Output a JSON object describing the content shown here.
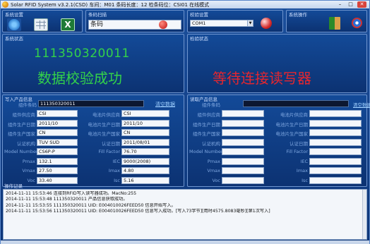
{
  "titlebar": {
    "title": "Solar RFID System v3.2.1(CSD) 车间：M01  条码长度：12  检条码位：CSI01  在线模式",
    "minimize": "–",
    "maximize": "□",
    "close": "✕"
  },
  "toolbar": {
    "label": "系统设置"
  },
  "barcode": {
    "label": "条码扫描",
    "field_label": "条码",
    "value": ""
  },
  "reader": {
    "label": "校验设置",
    "port": "COM1"
  },
  "system": {
    "label": "系统操作"
  },
  "status_left": {
    "label": "系统状态",
    "barcode_number": "111350320011",
    "message": "数据校验成功"
  },
  "status_right": {
    "label": "检验状态",
    "message": "等待连接读写器"
  },
  "write_panel": {
    "label": "写入产品信息",
    "product_no_label": "组件条码",
    "product_no": "111350320011",
    "clear_link": "清空数据",
    "rows_left": [
      {
        "label": "组件供应商",
        "value": "CSI"
      },
      {
        "label": "组件生产日期",
        "value": "2011/10"
      },
      {
        "label": "组件生产国家",
        "value": "CN"
      },
      {
        "label": "认证机构",
        "value": "TUV SUD"
      },
      {
        "label": "Model Number",
        "value": "CS6P-P"
      },
      {
        "label": "Pmax",
        "value": "132.1"
      },
      {
        "label": "Vmax",
        "value": "27.50"
      },
      {
        "label": "Voc",
        "value": "33.40"
      }
    ],
    "rows_right": [
      {
        "label": "电池片供应商",
        "value": "CSI"
      },
      {
        "label": "电池片生产日期",
        "value": "2011/10"
      },
      {
        "label": "电池片生产国家",
        "value": "CN"
      },
      {
        "label": "认证日期",
        "value": "2011/08/01"
      },
      {
        "label": "Fill Factor",
        "value": "76.70"
      },
      {
        "label": "IEC",
        "value": "9000(2008)"
      },
      {
        "label": "Imax",
        "value": "4.80"
      },
      {
        "label": "Isc",
        "value": "5.16"
      }
    ]
  },
  "read_panel": {
    "label": "读取产品信息",
    "product_no_label": "组件条码",
    "clear_link": "清空数据",
    "rows_left": [
      {
        "label": "组件供应商"
      },
      {
        "label": "组件生产日期"
      },
      {
        "label": "组件生产国家"
      },
      {
        "label": "认证机构"
      },
      {
        "label": "Model Number"
      },
      {
        "label": "Pmax"
      },
      {
        "label": "Vmax"
      },
      {
        "label": "Voc"
      }
    ],
    "rows_right": [
      {
        "label": "电池片供应商"
      },
      {
        "label": "电池片生产日期"
      },
      {
        "label": "电池片生产国家"
      },
      {
        "label": "认证日期"
      },
      {
        "label": "Fill Factor"
      },
      {
        "label": "IEC"
      },
      {
        "label": "Imax"
      },
      {
        "label": "Isc"
      }
    ]
  },
  "log": {
    "label": "操作记录",
    "lines": [
      "2014-11-11  15:53:46  连接到RFID写入读写器成功。MacNo:255",
      "2014-11-11  15:53:48  111350320011 产品信息获取成功。",
      "2014-11-11  15:53:55  111350320011 UID: E004010026FEED50 信息开始写入。",
      "2014-11-11  15:53:56  111350320011 UID: E004010026FEED50 信息写入成功。[写入73字节][用时4575.8083毫秒][第1次写入]"
    ]
  }
}
